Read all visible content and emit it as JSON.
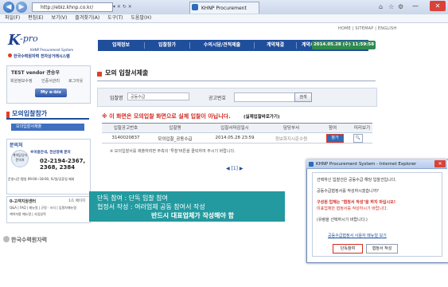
{
  "browser": {
    "url": "http://ebiz.khnp.co.kr/",
    "url_icons": "▾ ✕  ↻  ✕",
    "tab_title": "KHNP Procurement System",
    "back_icon": "◀",
    "forward_icon": "▶",
    "minimize": "—",
    "maximize": "□",
    "close": "✕",
    "home_icon": "⌂",
    "star_icon": "☆",
    "gear_icon": "⚙"
  },
  "menubar": [
    "파일(F)",
    "편집(E)",
    "보기(V)",
    "즐겨찾기(A)",
    "도구(T)",
    "도움말(H)"
  ],
  "toplinks": "HOME  |  SITEMAP  |  ENGLISH",
  "logo": {
    "k": "K",
    "pro": "-pro",
    "sub": "KHNP Procurement System",
    "company": "한국수력원자력 전자상거래시스템"
  },
  "nav": [
    "업체정보",
    "입찰참가",
    "수의시담/견적제출",
    "계약체결",
    "계약사후관리"
  ],
  "datebar": "2014.05.28 (수) 11:59:58",
  "user": {
    "name": "TEST vendor  관승우",
    "links": [
      "회원정보수정",
      "인증서관리",
      "로그아웃"
    ],
    "myebiz": "My e-biz"
  },
  "leftmenu": {
    "title": "모의입찰참가",
    "item": "모의입찰서제출"
  },
  "help": {
    "title": "문의처",
    "circle": "계약담당자문의처",
    "right": "※이용안내, 전산장애 문의",
    "phone": "02-2194-2367, 2368, 2384",
    "hours": "운영시간:평일 09:00~18:00, 토/일/공휴일 제외",
    "line2": ""
  },
  "faq": {
    "title": "0-고객지원센터",
    "page": "1/1 페이지",
    "item1": "Q&A | FAQ | 매뉴얼 | 규정 · 서식 | 입찰자매뉴얼",
    "item2": "계약자용 매뉴얼 | 사업실적"
  },
  "bottom_logo": "한국수력원자력",
  "content": {
    "title": "모의 입찰서제출",
    "search_label1": "입찰명",
    "search_value1": "공동수급",
    "search_label2": "공고번호",
    "search_button": "검색",
    "warning": "※ 이 화면은 모의입찰 화면으로 실제 입찰이 아닙니다.",
    "warning_extra": "(실제입찰바로가기)",
    "table": {
      "headers": [
        "입찰공고번호",
        "입찰명",
        "입찰서마감일시",
        "담당부서",
        "참여",
        "미리보기"
      ],
      "rows": [
        [
          "3140020837",
          "모의입찰_공동수급",
          "2014.05.28 23:59",
          "정보화지시준수원",
          "참가",
          "🔍"
        ]
      ]
    },
    "note": "※ 모의입찰서를 제출하려면 주측의 '투찰'버튼을 클릭하여 주시기 바랍니다.",
    "pager": "◀  [1]  ▶"
  },
  "overlay": {
    "line1": "단독 참여 : 단독 입찰 참여",
    "line2": "협정서 작성 : 여러업체 공동 참여서 작성",
    "line3": "반드시 대표업체가 작성해야 함"
  },
  "dialog": {
    "title": "KHNP Procurement System - Internet Explorer",
    "l1": "선택하신 입찰건은 공동수급 해당 입찰건입니다.",
    "l2": "공동수급협정서를 작성하시겠습니까?",
    "l3": "구성원 업체는 \"협정서 작성\"을 하지 마십시오!",
    "l4": "미표업체만 협정서를 작성하시기 바랍니다.",
    "l5": "(유령을 선택하시기 바랍니다.)",
    "link": "공동수급협정서 사용자 매뉴얼 보기",
    "btn1": "단독참여",
    "btn2": "협정서 작성"
  }
}
